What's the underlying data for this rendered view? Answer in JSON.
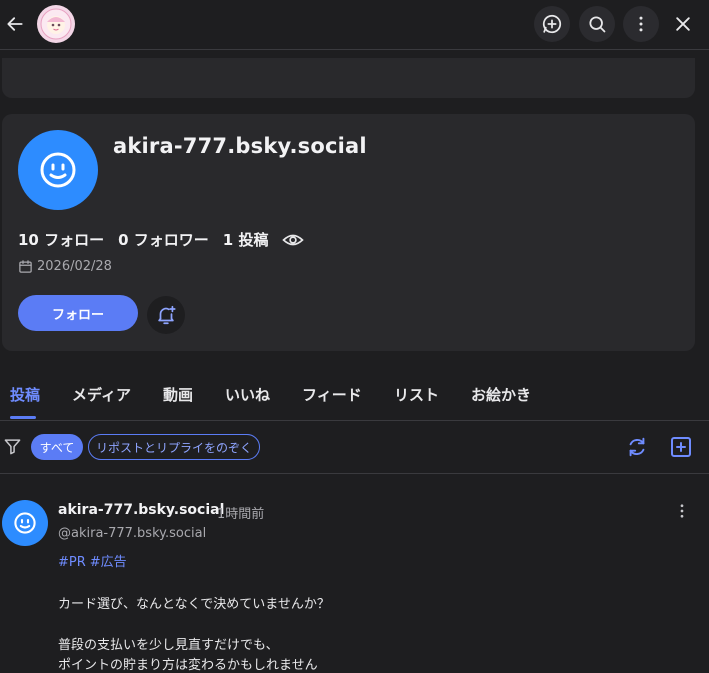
{
  "profile": {
    "display_name": "akira-777.bsky.social",
    "follows": "10 フォロー",
    "followers": "0 フォロワー",
    "posts": "1 投稿",
    "joined": "2026/02/28",
    "follow_label": "フォロー"
  },
  "tabs": [
    "投稿",
    "メディア",
    "動画",
    "いいね",
    "フィード",
    "リスト",
    "お絵かき"
  ],
  "filters": {
    "all": "すべて",
    "no_reposts": "リポストとリプライをのぞく"
  },
  "post": {
    "author": "akira-777.bsky.social",
    "time": "1時間前",
    "handle": "@akira-777.bsky.social",
    "tags": [
      "#PR",
      "#広告"
    ],
    "lines": [
      "カード選び、なんとなくで決めていませんか？",
      "普段の支払いを少し見直すだけでも、",
      "ポイントの貯まり方は変わるかもしれません"
    ]
  },
  "colors": {
    "accent": "#5b7cf5",
    "avatar": "#2d8cff",
    "card": "#29292c",
    "background": "#1e1e20"
  },
  "icons": {
    "back": "arrow-left-icon",
    "new_post": "chat-plus-icon",
    "search": "search-icon",
    "more": "more-vertical-icon",
    "close": "close-icon",
    "eye": "eye-icon",
    "calendar": "calendar-icon",
    "bell": "bell-plus-icon",
    "filter": "filter-icon",
    "refresh": "refresh-icon",
    "add": "add-square-icon"
  }
}
